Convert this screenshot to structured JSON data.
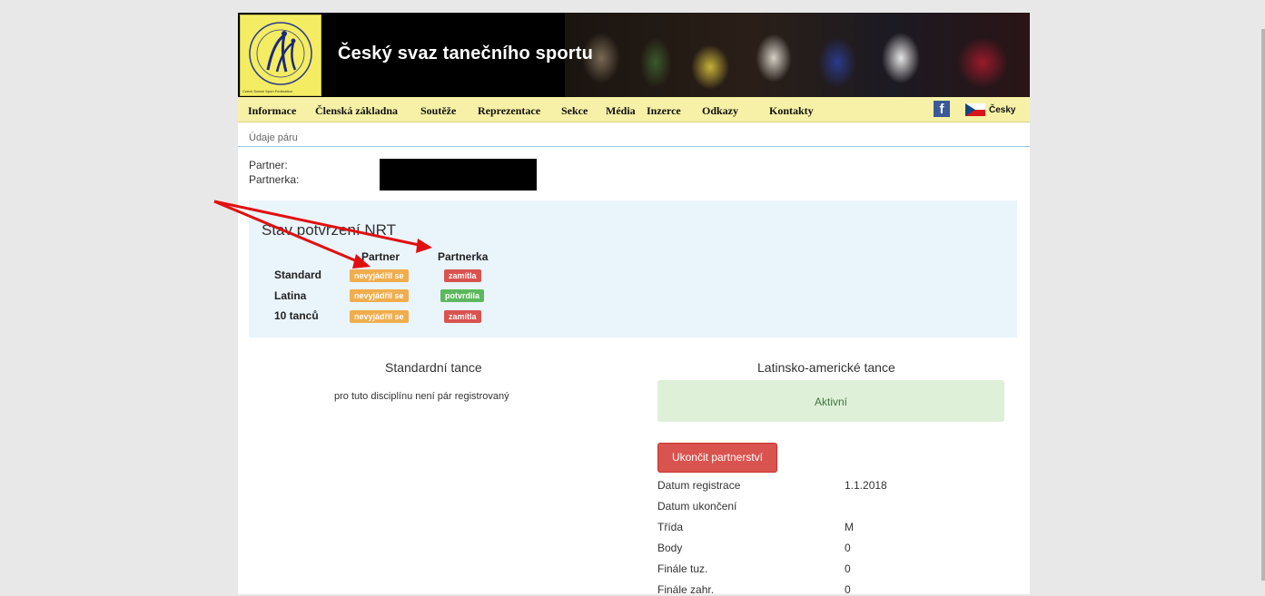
{
  "header": {
    "site_title": "Český svaz tanečního sportu",
    "logo_caption": "Czech Dance Sport Federation"
  },
  "nav": {
    "items": [
      {
        "label": "Informace"
      },
      {
        "label": "Členská základna"
      },
      {
        "label": "Soutěže"
      },
      {
        "label": "Reprezentace"
      },
      {
        "label": "Sekce"
      },
      {
        "label": "Média"
      },
      {
        "label": "Inzerce"
      },
      {
        "label": "Odkazy"
      },
      {
        "label": "Kontakty"
      }
    ],
    "facebook_icon": "facebook-icon",
    "language_label": "Česky",
    "flag_icon": "czech-flag-icon"
  },
  "breadcrumb": "Údaje páru",
  "couple": {
    "partner_label": "Partner:",
    "partnerka_label": "Partnerka:"
  },
  "nrt": {
    "title": "Stav potvrzení NRT",
    "col_partner": "Partner",
    "col_partnerka": "Partnerka",
    "rows": [
      {
        "label": "Standard",
        "partner": "nevyjádřil se",
        "partnerka": "zamítla"
      },
      {
        "label": "Latina",
        "partner": "nevyjádřil se",
        "partnerka": "potvrdila"
      },
      {
        "label": "10 tanců",
        "partner": "nevyjádřil se",
        "partnerka": "zamítla"
      }
    ],
    "colors": {
      "orange": "#f0ad4e",
      "red": "#d9534f",
      "green": "#5cb85c"
    }
  },
  "standard": {
    "title": "Standardní tance",
    "note": "pro tuto disciplínu není pár registrovaný"
  },
  "latin": {
    "title": "Latinsko-americké tance",
    "status": "Aktivní",
    "end_button": "Ukončit partnerství",
    "details": [
      {
        "label": "Datum registrace",
        "value": "1.1.2018"
      },
      {
        "label": "Datum ukončení",
        "value": ""
      },
      {
        "label": "Třída",
        "value": "M"
      },
      {
        "label": "Body",
        "value": "0"
      },
      {
        "label": "Finále tuz.",
        "value": "0"
      },
      {
        "label": "Finále zahr.",
        "value": "0"
      }
    ]
  }
}
